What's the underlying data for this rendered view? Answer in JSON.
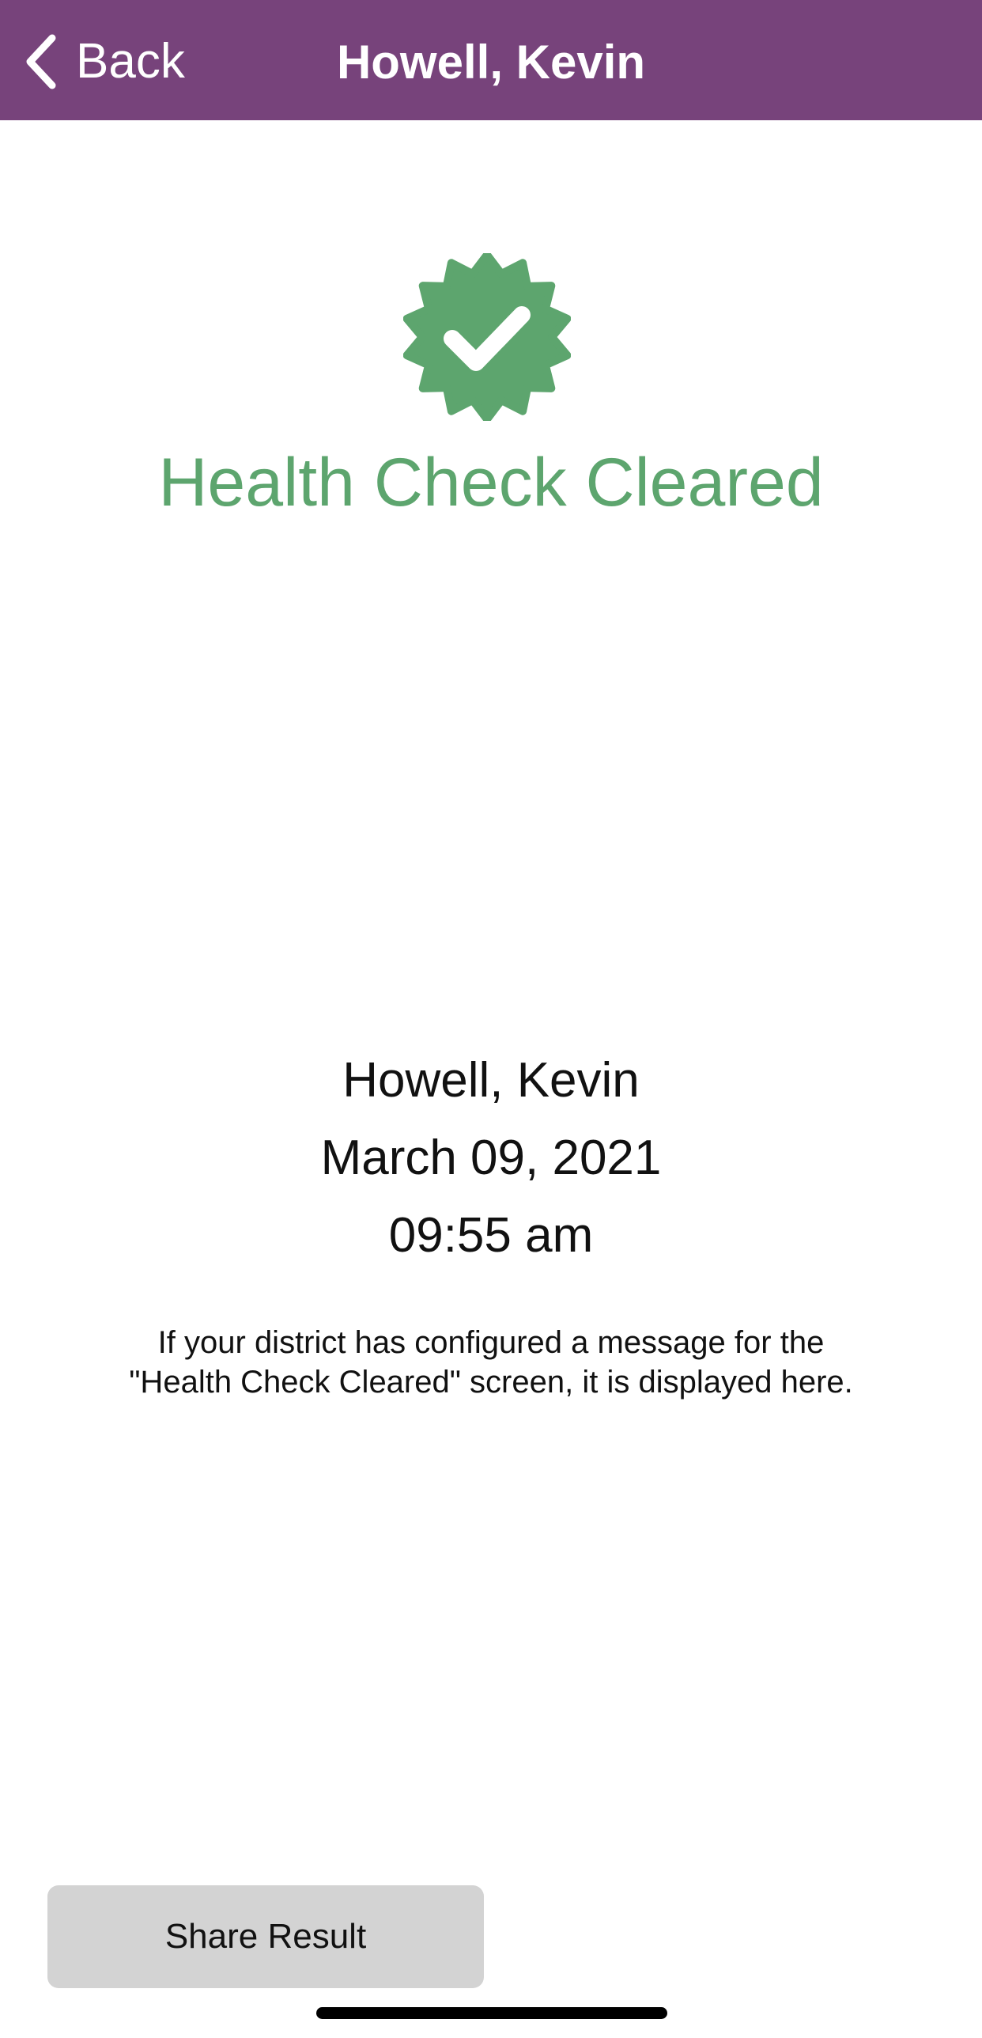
{
  "navbar": {
    "back_label": "Back",
    "title": "Howell, Kevin",
    "background_color": "#77437b",
    "back_icon": "chevron-left-icon"
  },
  "status": {
    "icon": "verified-badge-check-icon",
    "title": "Health Check Cleared",
    "color": "#5da56e"
  },
  "record": {
    "name": "Howell, Kevin",
    "date": "March 09, 2021",
    "time": "09:55 am"
  },
  "message": "If your district has configured a message for the \"Health Check Cleared\" screen, it is displayed here.",
  "actions": {
    "share_label": "Share Result"
  }
}
